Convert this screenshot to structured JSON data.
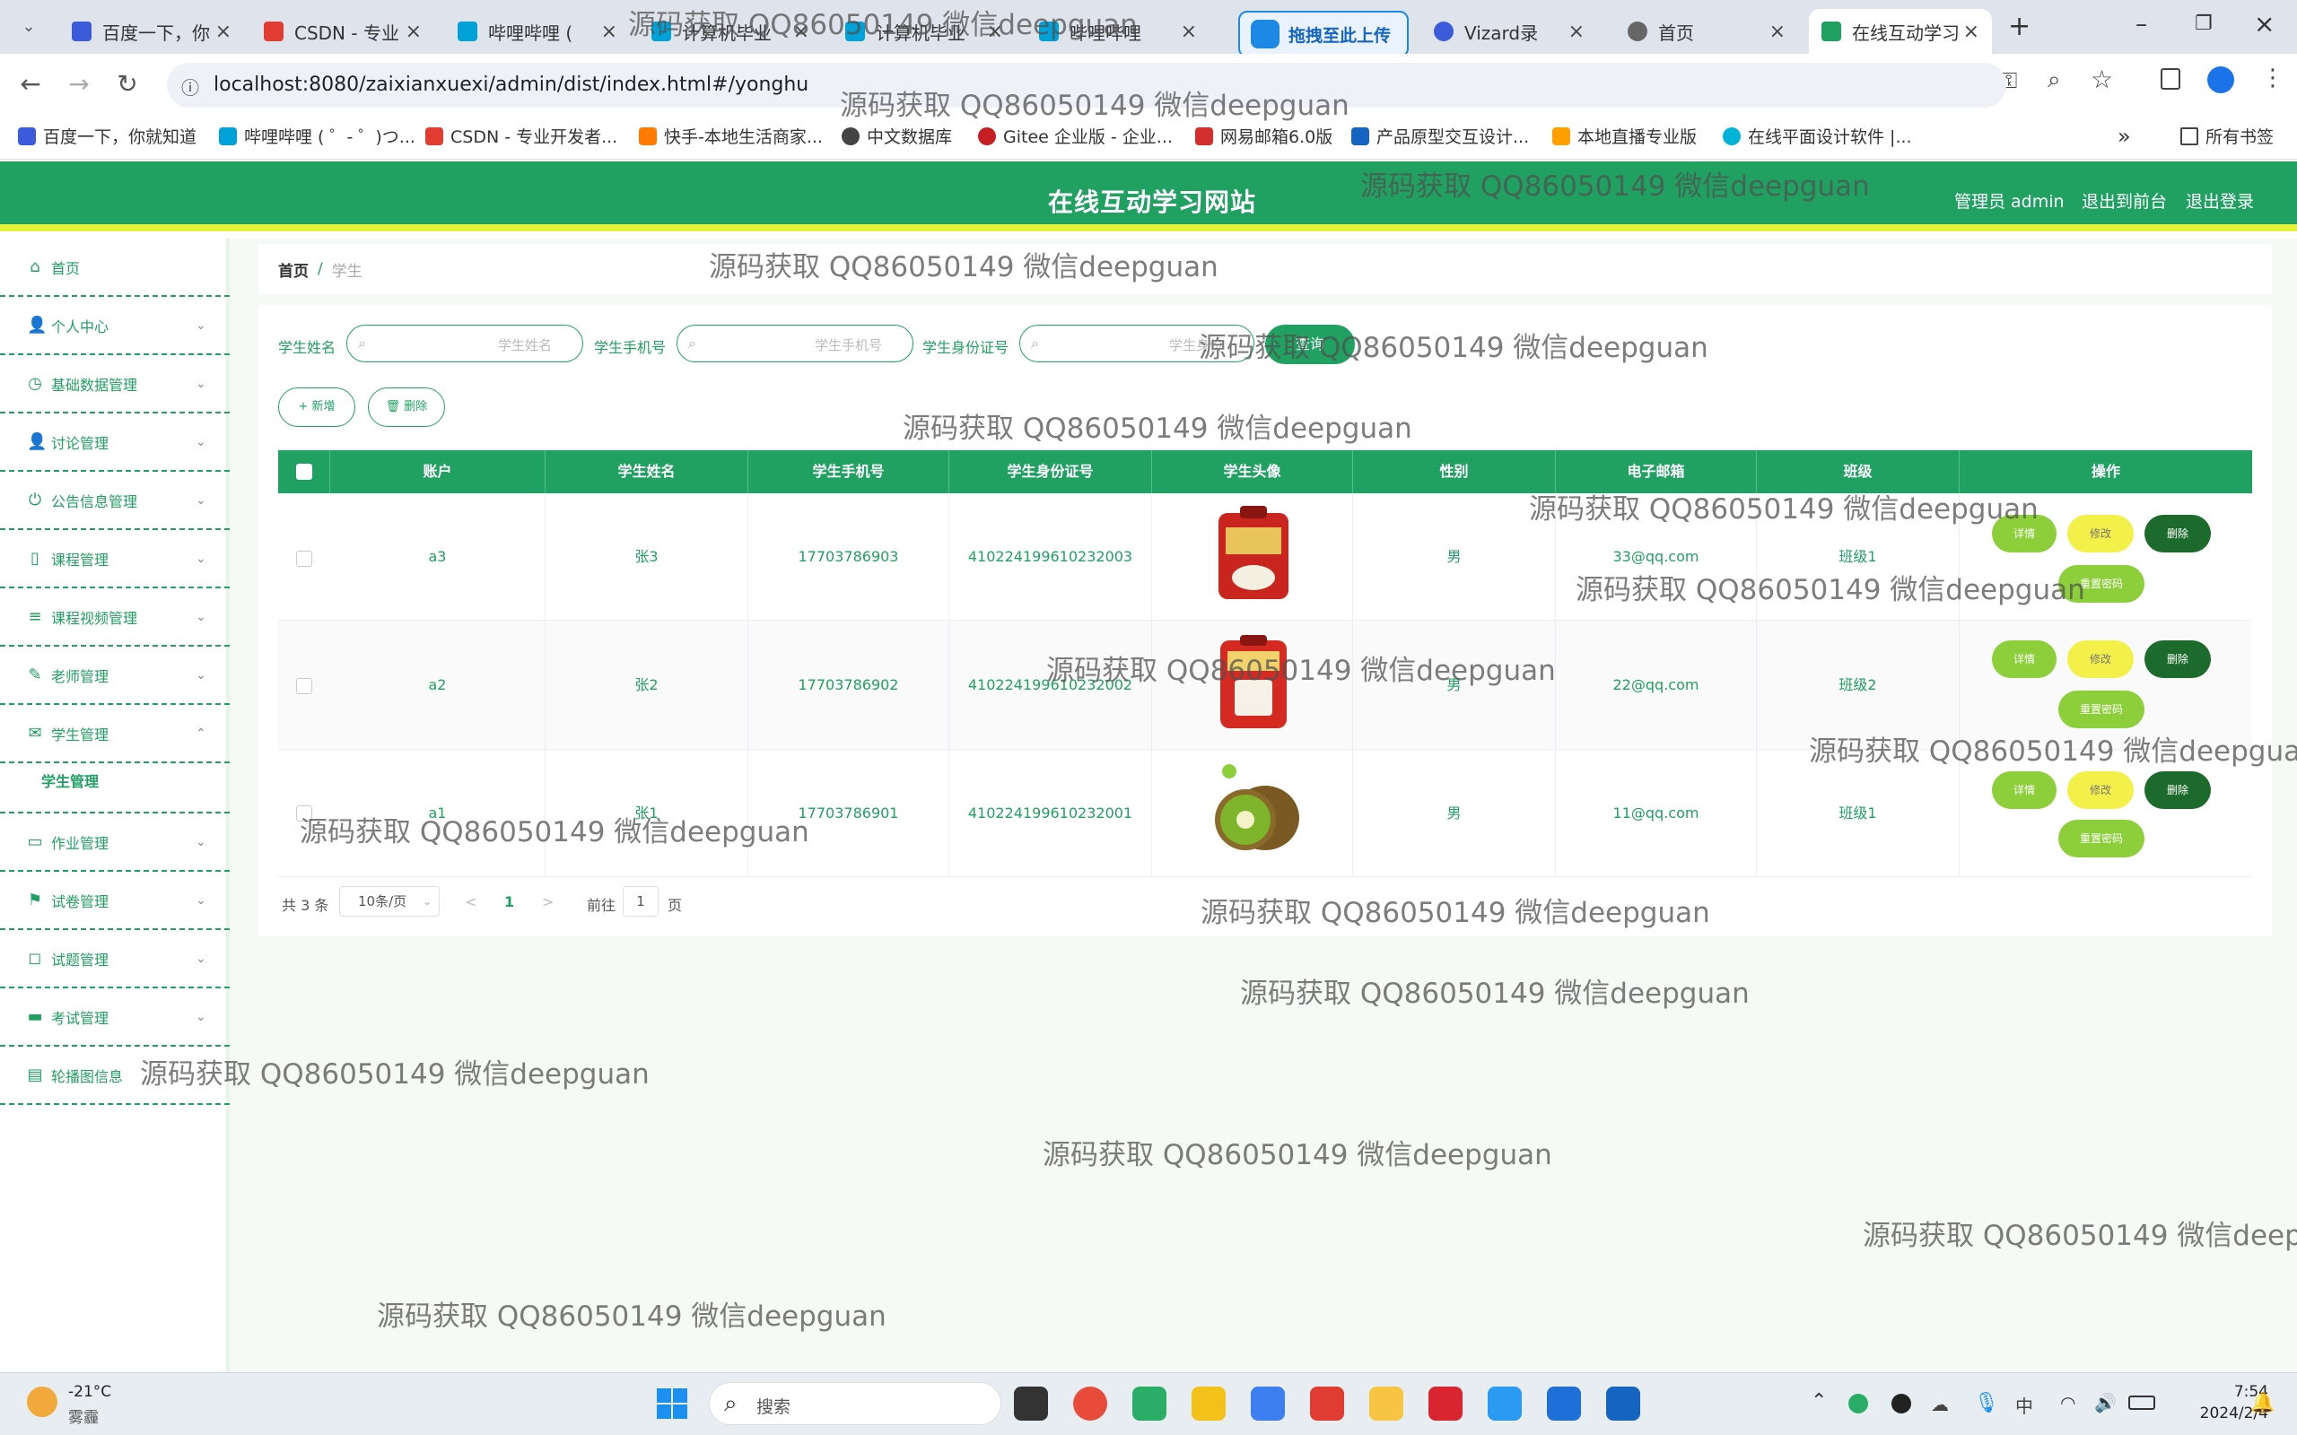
{
  "browser": {
    "tabs": [
      {
        "label": "百度一下，你",
        "color": "#3b5bdb"
      },
      {
        "label": "CSDN - 专业",
        "color": "#e03c31"
      },
      {
        "label": "哔哩哔哩 (",
        "color": "#00a1d6"
      },
      {
        "label": "计算机毕业",
        "color": "#00a1d6"
      },
      {
        "label": "计算机毕业",
        "color": "#00a1d6"
      },
      {
        "label": "哔哩哔哩",
        "color": "#00a1d6"
      },
      {
        "label": "拖拽至此上传",
        "color": "#1e88e5"
      },
      {
        "label": "Vizard录",
        "color": "#3b5bdb"
      },
      {
        "label": "首页",
        "color": "#666666"
      },
      {
        "label": "在线互动学习",
        "color": "#20a162"
      }
    ],
    "url": "localhost:8080/zaixianxuexi/admin/dist/index.html#/yonghu",
    "bookmarks": [
      "百度一下，你就知道",
      "哔哩哔哩 ( ゜- ゜)つ...",
      "CSDN - 专业开发者...",
      "快手-本地生活商家...",
      "中文数据库",
      "Gitee 企业版 - 企业...",
      "网易邮箱6.0版",
      "产品原型交互设计...",
      "本地直播专业版",
      "在线平面设计软件 |..."
    ],
    "bookmarks_more": "»",
    "all_bookmarks": "所有书签"
  },
  "header": {
    "title": "在线互动学习网站",
    "admin": "管理员 admin",
    "to_front": "退出到前台",
    "logout": "退出登录"
  },
  "sidebar": {
    "items": [
      {
        "label": "首页",
        "icon": "⌂"
      },
      {
        "label": "个人中心",
        "icon": "👤"
      },
      {
        "label": "基础数据管理",
        "icon": "◷"
      },
      {
        "label": "讨论管理",
        "icon": "👤"
      },
      {
        "label": "公告信息管理",
        "icon": "⏻"
      },
      {
        "label": "课程管理",
        "icon": "▯"
      },
      {
        "label": "课程视频管理",
        "icon": "≡"
      },
      {
        "label": "老师管理",
        "icon": "✎"
      },
      {
        "label": "学生管理",
        "icon": "✉"
      },
      {
        "label": "作业管理",
        "icon": "▭"
      },
      {
        "label": "试卷管理",
        "icon": "⚑"
      },
      {
        "label": "试题管理",
        "icon": "◻"
      },
      {
        "label": "考试管理",
        "icon": "▬"
      },
      {
        "label": "轮播图信息",
        "icon": "▤"
      }
    ],
    "submenu": "学生管理"
  },
  "breadcrumb": {
    "home": "首页",
    "sep": "/",
    "current": "学生"
  },
  "search": {
    "name_label": "学生姓名",
    "name_placeholder": "学生姓名",
    "phone_label": "学生手机号",
    "phone_placeholder": "学生手机号",
    "id_label": "学生身份证号",
    "id_placeholder": "学生身份",
    "query": "查询"
  },
  "actions": {
    "add": "+ 新增",
    "delete": "🗑 删除"
  },
  "table": {
    "headers": [
      "账户",
      "学生姓名",
      "学生手机号",
      "学生身份证号",
      "学生头像",
      "性别",
      "电子邮箱",
      "班级",
      "操作"
    ],
    "rows": [
      {
        "account": "a3",
        "name": "张3",
        "phone": "17703786903",
        "idcard": "410224199610232003",
        "avatar": "rice-bag-icon",
        "gender": "男",
        "email": "33@qq.com",
        "class": "班级1"
      },
      {
        "account": "a2",
        "name": "张2",
        "phone": "17703786902",
        "idcard": "410224199610232002",
        "avatar": "rice-bag-icon",
        "gender": "男",
        "email": "22@qq.com",
        "class": "班级2"
      },
      {
        "account": "a1",
        "name": "张1",
        "phone": "17703786901",
        "idcard": "410224199610232001",
        "avatar": "kiwi-icon",
        "gender": "男",
        "email": "11@qq.com",
        "class": "班级1"
      }
    ],
    "op_detail": "详情",
    "op_edit": "修改",
    "op_delete": "删除",
    "op_reset": "重置密码"
  },
  "pagination": {
    "total": "共 3 条",
    "page_size": "10条/页",
    "prev": "<",
    "page": "1",
    "next": ">",
    "goto": "前往",
    "goto_value": "1",
    "page_unit": "页"
  },
  "watermark": "源码获取 QQ86050149 微信deepguan",
  "taskbar": {
    "temperature": "-21°C",
    "weather": "雾霾",
    "search": "搜索",
    "time": "7:54",
    "date": "2024/2/4"
  },
  "colors": {
    "brand": "#20a162",
    "accent": "#e5f23a"
  }
}
